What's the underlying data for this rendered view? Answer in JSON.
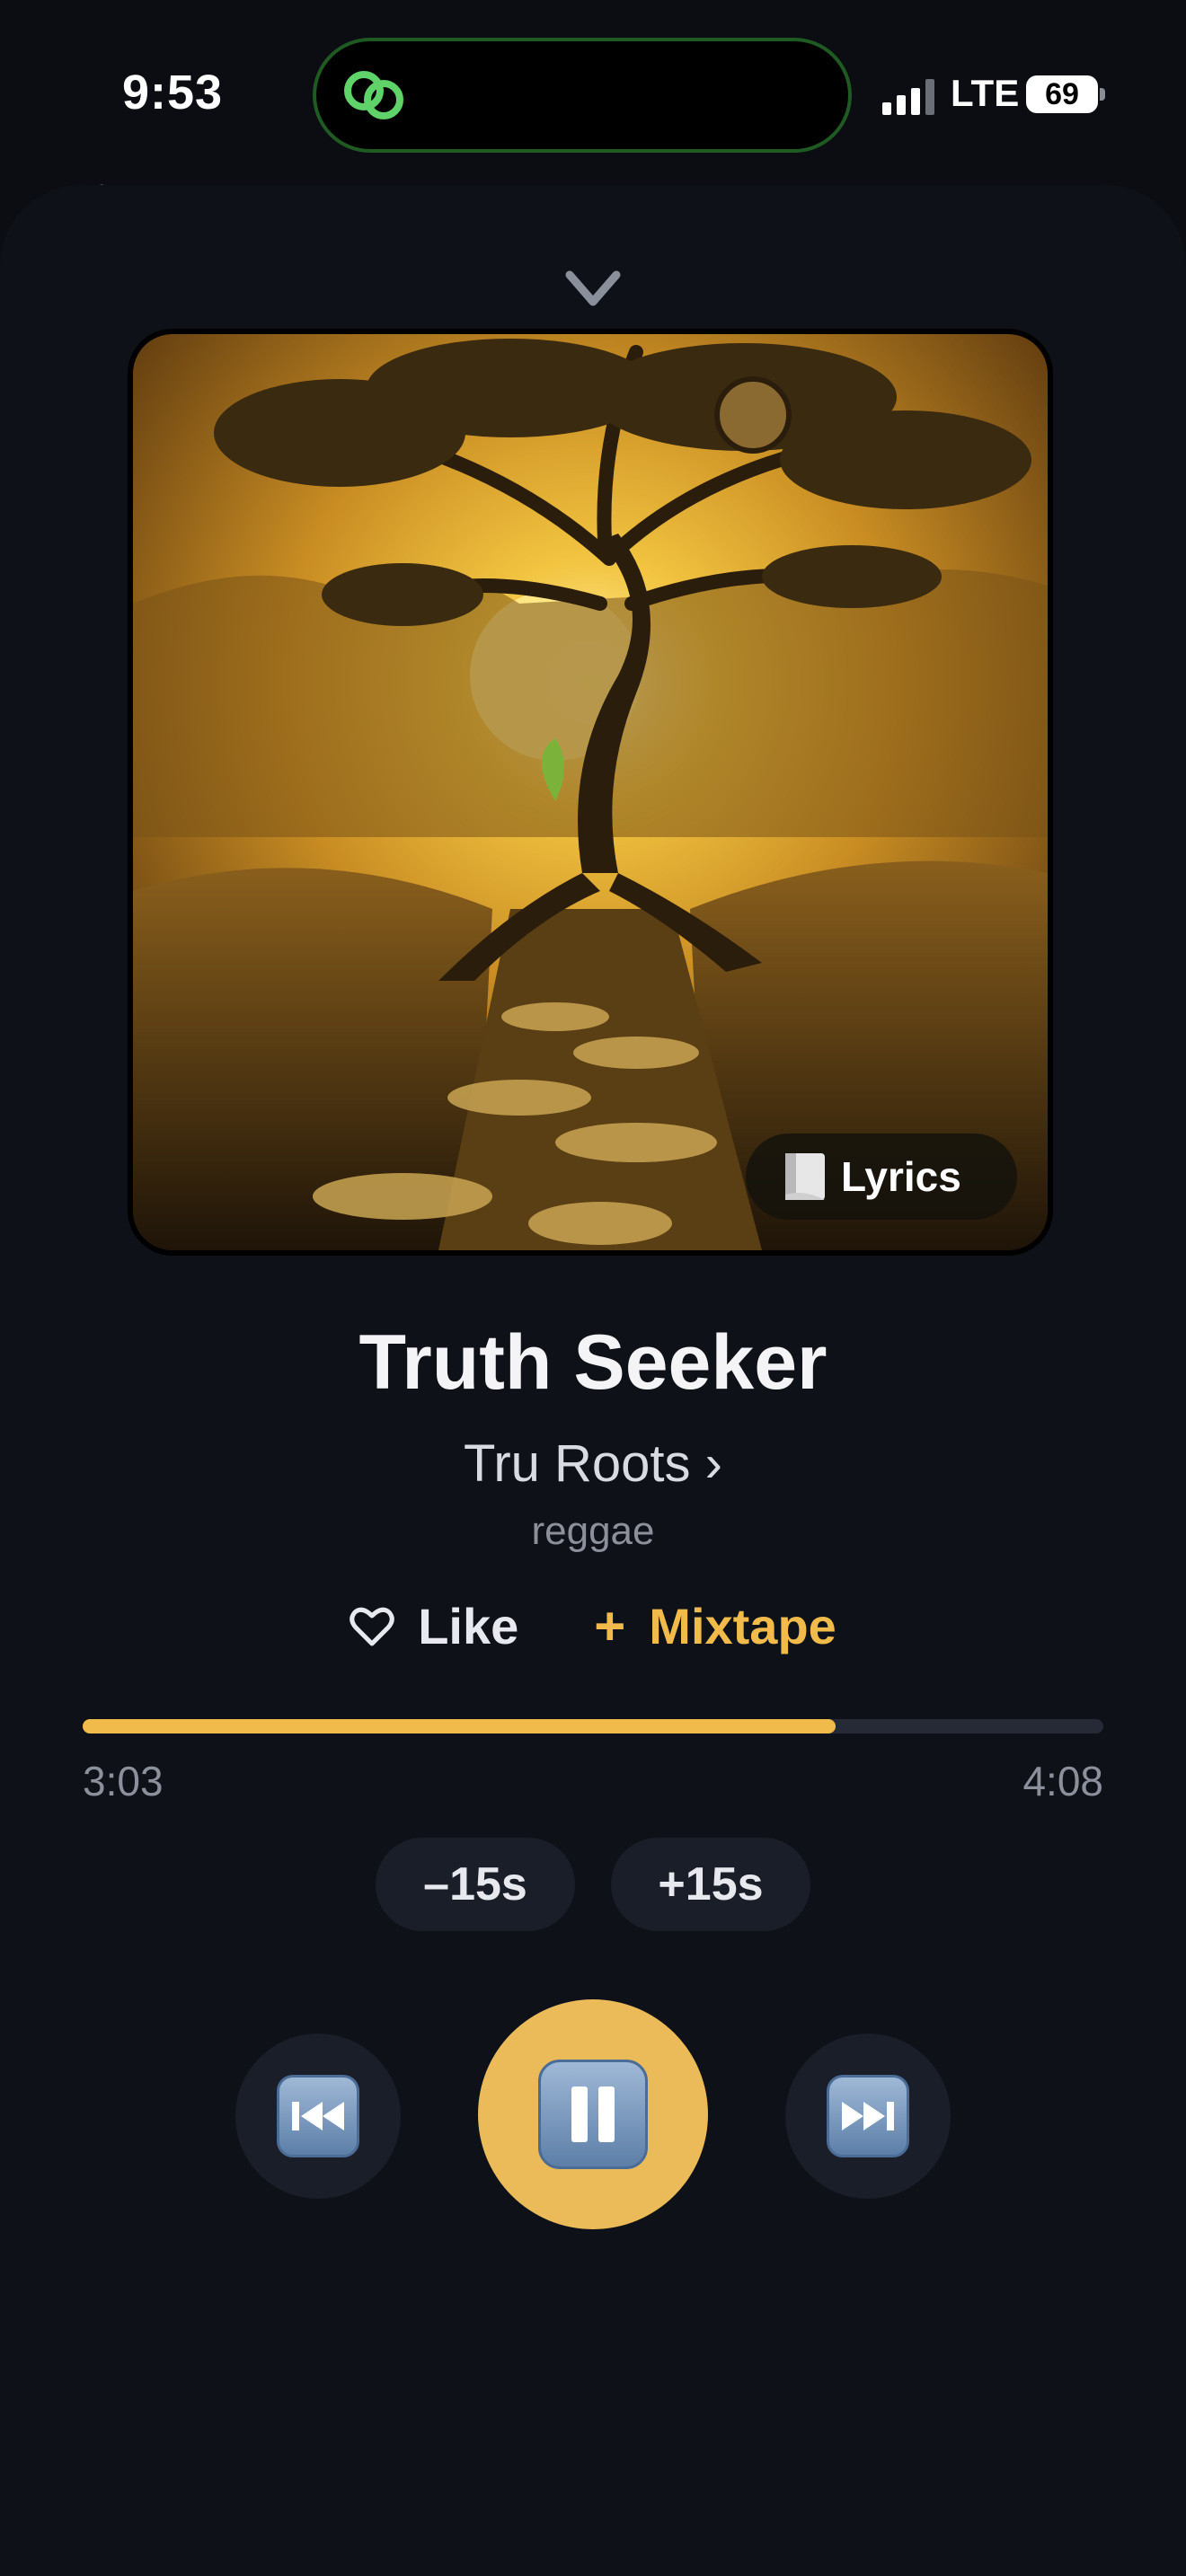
{
  "status_bar": {
    "time": "9:53",
    "network": "LTE",
    "battery": "69"
  },
  "player": {
    "lyrics_label": "Lyrics",
    "title": "Truth Seeker",
    "artist": "Tru Roots ›",
    "genre": "reggae",
    "like_label": "Like",
    "mixtape_plus": "+",
    "mixtape_label": "Mixtape",
    "elapsed": "3:03",
    "total": "4:08",
    "progress_fraction": 0.738,
    "back_label": "–15s",
    "forward_label": "+15s"
  },
  "colors": {
    "accent": "#f0bb4a",
    "background": "#0b0d12",
    "sheet": "#0e1118",
    "control_bg": "#1a1e28",
    "play_bg": "#ebbb59"
  },
  "icons": [
    "chain-link-icon",
    "signal-icon",
    "battery-icon",
    "chevron-down-icon",
    "scroll-icon",
    "heart-icon",
    "previous-track-icon",
    "pause-icon",
    "next-track-icon"
  ]
}
